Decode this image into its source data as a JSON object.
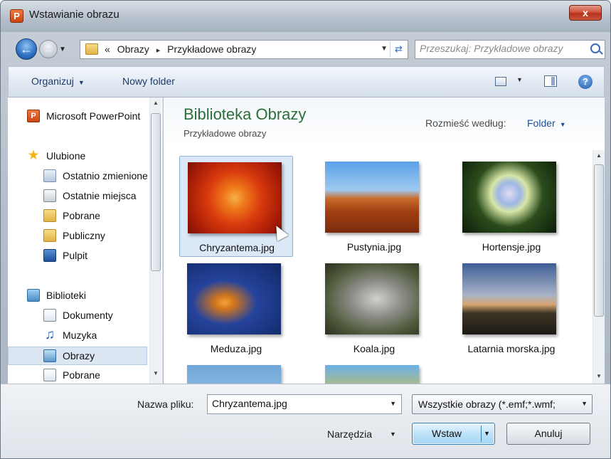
{
  "window": {
    "title": "Wstawianie obrazu",
    "close_glyph": "x",
    "app_icon_letter": "P"
  },
  "address": {
    "overflow": "«",
    "crumbs": [
      "Obrazy",
      "Przykładowe obrazy"
    ],
    "separator": "▸"
  },
  "search": {
    "placeholder": "Przeszukaj: Przykładowe obrazy"
  },
  "toolbar": {
    "organize": "Organizuj",
    "new_folder": "Nowy folder",
    "help_glyph": "?"
  },
  "nav": {
    "items": [
      {
        "label": "Microsoft PowerPoint",
        "icon": "powerpoint-icon"
      },
      {
        "label": "Ulubione",
        "icon": "star-icon"
      },
      {
        "label": "Ostatnio zmienione",
        "icon": "recent-icon"
      },
      {
        "label": "Ostatnie miejsca",
        "icon": "recent-places-icon"
      },
      {
        "label": "Pobrane",
        "icon": "downloads-folder-icon"
      },
      {
        "label": "Publiczny",
        "icon": "folder-icon"
      },
      {
        "label": "Pulpit",
        "icon": "desktop-icon"
      },
      {
        "label": "Biblioteki",
        "icon": "libraries-icon"
      },
      {
        "label": "Dokumenty",
        "icon": "documents-icon"
      },
      {
        "label": "Muzyka",
        "icon": "music-icon"
      },
      {
        "label": "Obrazy",
        "icon": "pictures-icon"
      },
      {
        "label": "Pobrane",
        "icon": "downloads-icon"
      }
    ],
    "selected": "Obrazy"
  },
  "library": {
    "title": "Biblioteka Obrazy",
    "subtitle": "Przykładowe obrazy",
    "arrange_label": "Rozmieść według:",
    "arrange_value": "Folder"
  },
  "files": [
    {
      "name": "Chryzantema.jpg",
      "selected": true
    },
    {
      "name": "Pustynia.jpg",
      "selected": false
    },
    {
      "name": "Hortensje.jpg",
      "selected": false
    },
    {
      "name": "Meduza.jpg",
      "selected": false
    },
    {
      "name": "Koala.jpg",
      "selected": false
    },
    {
      "name": "Latarnia morska.jpg",
      "selected": false
    },
    {
      "name": "",
      "selected": false
    },
    {
      "name": "",
      "selected": false
    }
  ],
  "bottom": {
    "filename_label": "Nazwa pliku:",
    "filename_value": "Chryzantema.jpg",
    "filetype_value": "Wszystkie obrazy (*.emf;*.wmf;",
    "tools_label": "Narzędzia",
    "insert_label": "Wstaw",
    "cancel_label": "Anuluj"
  }
}
